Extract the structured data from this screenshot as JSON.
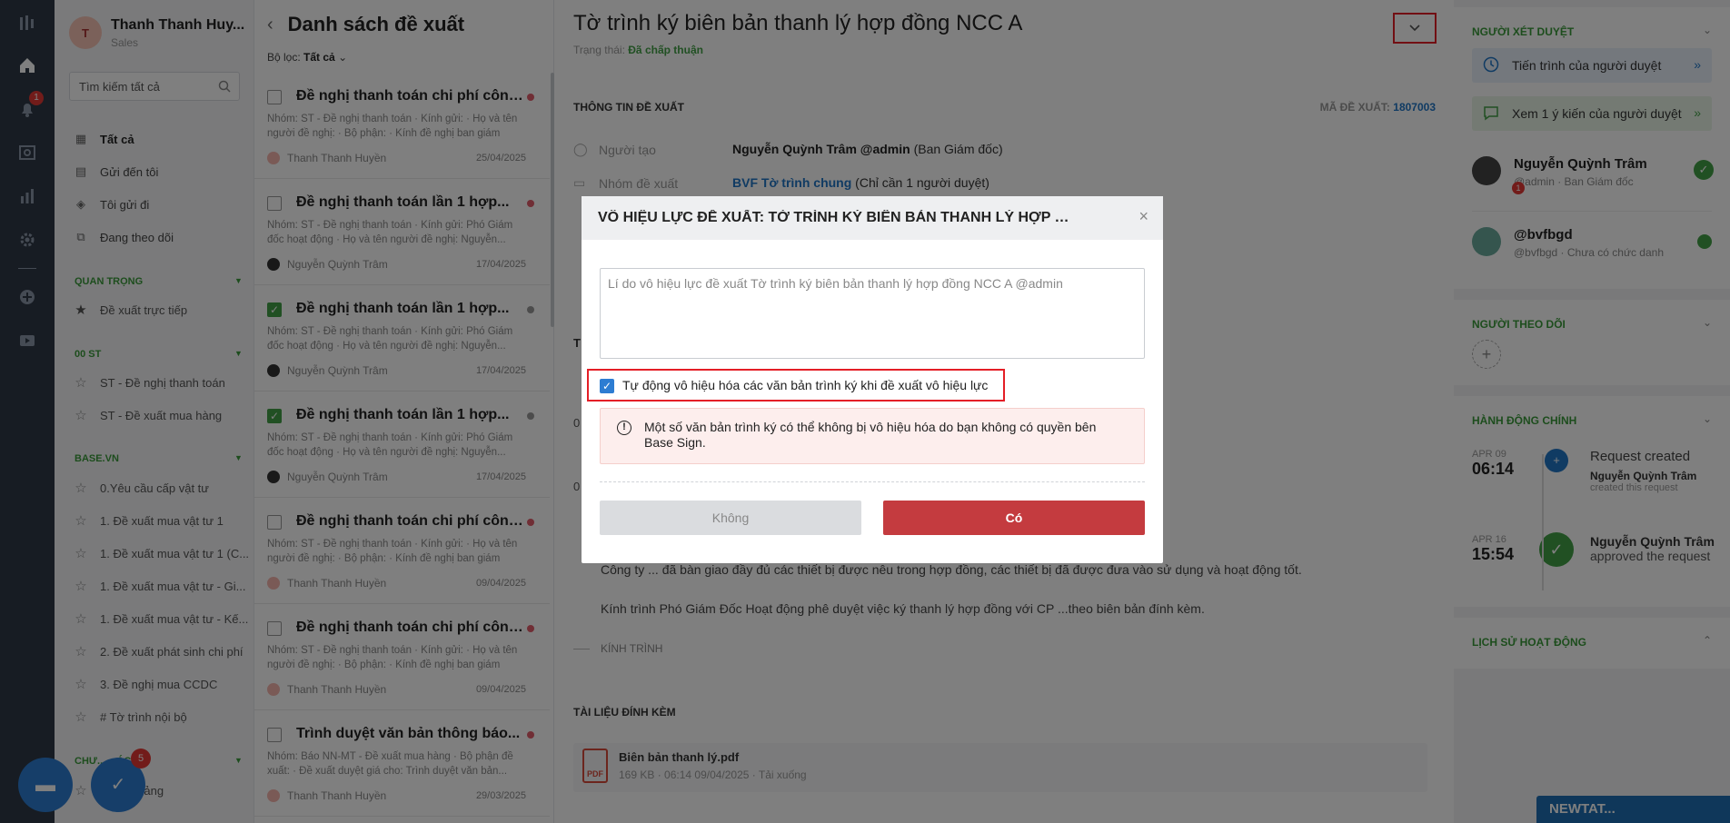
{
  "rail": {
    "notif_badge": "1"
  },
  "user": {
    "name": "Thanh Thanh Huy...",
    "role": "Sales",
    "initial": "T"
  },
  "search": {
    "placeholder": "Tìm kiếm tất cả"
  },
  "nav": {
    "all": "Tất cả",
    "sent_to_me": "Gửi đến tôi",
    "i_sent": "Tôi gửi đi",
    "following": "Đang theo dõi"
  },
  "sections": {
    "important": "QUAN TRỌNG",
    "important_items": [
      "Đề xuất trực tiếp"
    ],
    "st": "00 ST",
    "st_items": [
      "ST - Đề nghị thanh toán",
      "ST - Đề xuất mua hàng"
    ],
    "base": "BASE.VN",
    "base_items": [
      "0.Yêu cầu cấp vật tư",
      "1. Đề xuất mua vật tư 1",
      "1. Đề xuất mua vật tư 1 (C...",
      "1. Đề xuất mua vật tư - Gi...",
      "1. Đề xuất mua vật tư - Kế...",
      "2. Đề xuất phát sinh chi phí",
      "3. Đề nghị mua CCDC",
      "# Tờ trình nội bộ"
    ],
    "other": "CHƯ... ...ÁC",
    "other_items": [
      "...khai giảng"
    ]
  },
  "list": {
    "header": "Danh sách đề xuất",
    "filter_label": "Bộ lọc:",
    "filter_value": "Tất cả",
    "items": [
      {
        "title": "Đề nghị thanh toán chi phí công...",
        "desc": "Nhóm: ST - Đề nghị thanh toán · Kính gửi: · Họ và tên người đề nghị: · Bộ phận: · Kính đề nghị ban giám đốc...",
        "author": "Thanh Thanh Huyền",
        "date": "25/04/2025"
      },
      {
        "title": "Đề nghị thanh toán lần 1 hợp...",
        "desc": "Nhóm: ST - Đề nghị thanh toán · Kính gửi: Phó Giám đốc hoạt động · Họ và tên người đề nghị: Nguyễn...",
        "author": "Nguyễn Quỳnh Trâm",
        "date": "17/04/2025"
      },
      {
        "title": "Đề nghị thanh toán lần 1 hợp...",
        "desc": "Nhóm: ST - Đề nghị thanh toán · Kính gửi: Phó Giám đốc hoạt động · Họ và tên người đề nghị: Nguyễn...",
        "author": "Nguyễn Quỳnh Trâm",
        "date": "17/04/2025"
      },
      {
        "title": "Đề nghị thanh toán lần 1 hợp...",
        "desc": "Nhóm: ST - Đề nghị thanh toán · Kính gửi: Phó Giám đốc hoạt động · Họ và tên người đề nghị: Nguyễn...",
        "author": "Nguyễn Quỳnh Trâm",
        "date": "17/04/2025"
      },
      {
        "title": "Đề nghị thanh toán chi phí công...",
        "desc": "Nhóm: ST - Đề nghị thanh toán · Kính gửi: · Họ và tên người đề nghị: · Bộ phận: · Kính đề nghị ban giám đốc...",
        "author": "Thanh Thanh Huyền",
        "date": "09/04/2025"
      },
      {
        "title": "Đề nghị thanh toán chi phí công...",
        "desc": "Nhóm: ST - Đề nghị thanh toán · Kính gửi: · Họ và tên người đề nghị: · Bộ phận: · Kính đề nghị ban giám đốc...",
        "author": "Thanh Thanh Huyền",
        "date": "09/04/2025"
      },
      {
        "title": "Trình duyệt văn bản thông báo...",
        "desc": "Nhóm: Báo NN-MT - Đề xuất mua hàng · Bộ phận đề xuất: · Đề xuất duyệt giá cho: Trình duyệt văn bản...",
        "author": "Thanh Thanh Huyền",
        "date": "29/03/2025"
      }
    ]
  },
  "main": {
    "title": "Tờ trình ký biên bản thanh lý hợp đồng NCC A",
    "status_label": "Trạng thái:",
    "status_value": "Đã chấp thuận",
    "info_section": "THÔNG TIN ĐỀ XUẤT",
    "code_label": "MÃ ĐỀ XUẤT:",
    "code_value": "1807003",
    "creator_label": "Người tạo",
    "creator_name": "Nguyễn Quỳnh Trâm @admin",
    "creator_dept": "(Ban Giám đốc)",
    "group_label": "Nhóm đề xuất",
    "group_link": "BVF Tờ trình chung",
    "group_note": "(Chỉ cần 1 người duyệt)",
    "hidden_t": "T",
    "hidden_0a": "0",
    "hidden_0b": "0",
    "body1": "Công ty ... đã bàn giao đầy đủ các thiết bị được nêu trong hợp đồng, các thiết bị đã được đưa vào sử dụng và hoạt động tốt.",
    "body2": "Kính trình Phó Giám Đốc Hoạt động phê duyệt việc ký thanh lý hợp đồng với CP ...theo biên bản đính kèm.",
    "kinhtrinh": "KÍNH TRÌNH",
    "attach_section": "TÀI LIỆU ĐÍNH KÈM",
    "attach_name": "Biên bản thanh lý.pdf",
    "attach_meta": "169 KB · 06:14 09/04/2025 · Tải xuống",
    "pdf_label": "PDF"
  },
  "right": {
    "reviewers": "NGƯỜI XÉT DUYỆT",
    "progress": "Tiến trình của người duyệt",
    "opinions": "Xem 1 ý kiến của người duyệt",
    "approvers": [
      {
        "name": "Nguyễn Quỳnh Trâm",
        "sub": "@admin · Ban Giám đốc",
        "badge": "1"
      },
      {
        "name": "@bvfbgd",
        "sub": "@bvfbgd · Chưa có chức danh"
      }
    ],
    "followers": "NGƯỜI THEO DÕI",
    "main_actions": "HÀNH ĐỘNG CHÍNH",
    "timeline": [
      {
        "month": "APR 09",
        "time": "06:14",
        "event": "Request created",
        "who": "Nguyễn Quỳnh Trâm",
        "what": "created this request"
      },
      {
        "month": "APR 16",
        "time": "15:54",
        "event": "",
        "who": "Nguyễn Quỳnh Trâm",
        "what": "approved the request"
      }
    ],
    "history": "LỊCH SỬ HOẠT ĐỘNG",
    "newtat": "NEWTAT..."
  },
  "modal": {
    "title": "VÔ HIỆU LỰC ĐỀ XUẤT: TỜ TRÌNH KÝ BIÊN BẢN THANH LÝ HỢP ĐỒ...",
    "placeholder": "Lí do vô hiệu lực đề xuất Tờ trình ký biên bản thanh lý hợp đồng NCC A @admin",
    "checkbox_label": "Tự động vô hiệu hóa các văn bản trình ký khi đề xuất vô hiệu lực",
    "warning": "Một số văn bản trình ký có thể không bị vô hiệu hóa do bạn không có quyền bên Base Sign.",
    "no": "Không",
    "yes": "Có"
  },
  "fab": {
    "badge": "5"
  },
  "colors": {
    "accent_green": "#43a047",
    "danger": "#c43b3f",
    "link_blue": "#2176c7",
    "highlight_red": "#e41e26"
  }
}
